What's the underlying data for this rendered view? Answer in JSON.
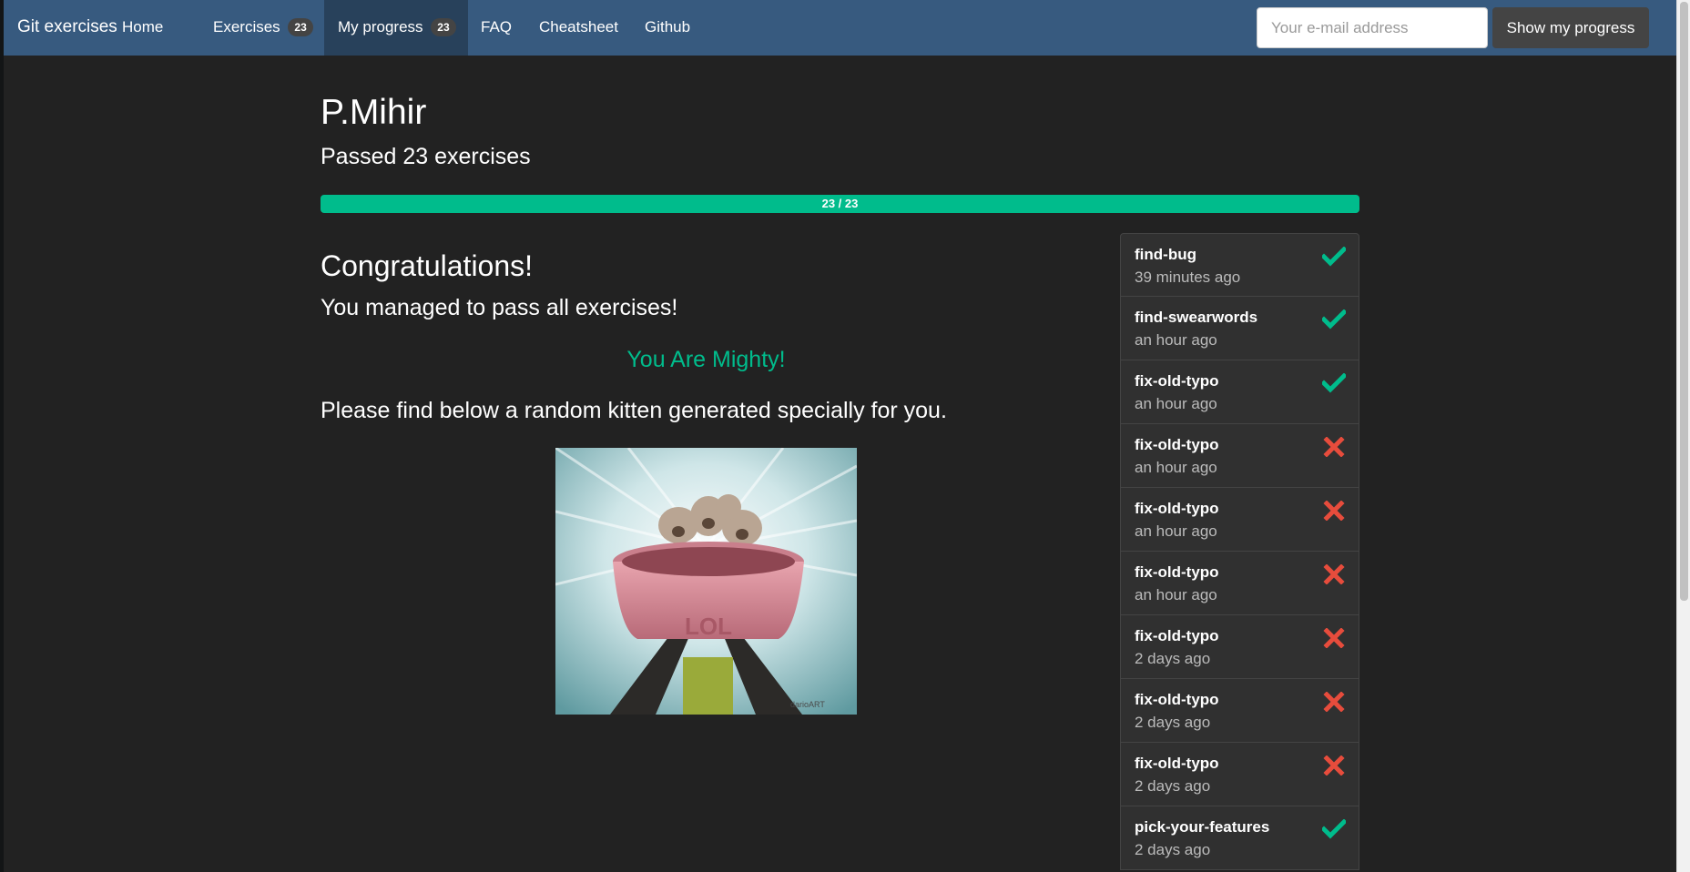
{
  "navbar": {
    "brand": "Git exercises",
    "items": [
      {
        "label": "Home"
      },
      {
        "label": "Exercises",
        "badge": "23"
      },
      {
        "label": "My progress",
        "badge": "23",
        "active": true
      },
      {
        "label": "FAQ"
      },
      {
        "label": "Cheatsheet"
      },
      {
        "label": "Github"
      }
    ],
    "email_placeholder": "Your e-mail address",
    "show_progress_label": "Show my progress"
  },
  "profile": {
    "username": "P.Mihir",
    "passed_text": "Passed 23 exercises",
    "progress_label": "23 / 23",
    "progress_fraction": 1.0
  },
  "congrats": {
    "title": "Congratulations!",
    "message": "You managed to pass all exercises!",
    "mighty": "You Are Mighty!",
    "kitten_text": "Please find below a random kitten generated specially for you.",
    "image_credit": "darioART",
    "image_text": "LOL"
  },
  "history": [
    {
      "name": "find-bug",
      "time": "39 minutes ago",
      "status": "passed"
    },
    {
      "name": "find-swearwords",
      "time": "an hour ago",
      "status": "passed"
    },
    {
      "name": "fix-old-typo",
      "time": "an hour ago",
      "status": "passed"
    },
    {
      "name": "fix-old-typo",
      "time": "an hour ago",
      "status": "failed"
    },
    {
      "name": "fix-old-typo",
      "time": "an hour ago",
      "status": "failed"
    },
    {
      "name": "fix-old-typo",
      "time": "an hour ago",
      "status": "failed"
    },
    {
      "name": "fix-old-typo",
      "time": "2 days ago",
      "status": "failed"
    },
    {
      "name": "fix-old-typo",
      "time": "2 days ago",
      "status": "failed"
    },
    {
      "name": "fix-old-typo",
      "time": "2 days ago",
      "status": "failed"
    },
    {
      "name": "pick-your-features",
      "time": "2 days ago",
      "status": "passed"
    }
  ],
  "colors": {
    "navbar": "#375a7f",
    "success": "#00bc8c",
    "danger": "#e74c3c"
  }
}
